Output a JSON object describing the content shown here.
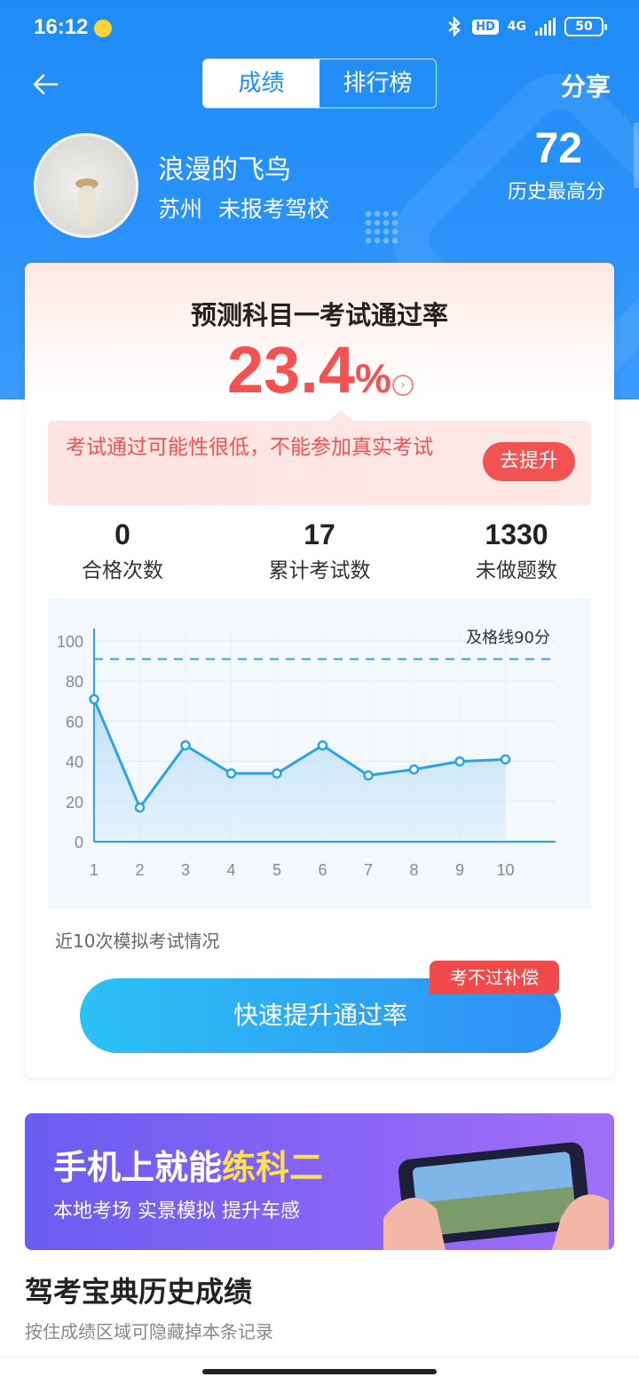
{
  "status_bar": {
    "time": "16:12",
    "network": "4G",
    "hd": "HD",
    "battery": "50"
  },
  "header": {
    "tabs": [
      {
        "label": "成绩",
        "active": true
      },
      {
        "label": "排行榜",
        "active": false
      }
    ],
    "share_label": "分享"
  },
  "profile": {
    "name": "浪漫的飞鸟",
    "city": "苏州",
    "school": "未报考驾校",
    "best_score": "72",
    "best_score_label": "历史最高分"
  },
  "prediction": {
    "title": "预测科目一考试通过率",
    "value": "23.4",
    "unit": "%",
    "alert_text": "考试通过可能性很低，不能参加真实考试",
    "alert_button": "去提升"
  },
  "stats": [
    {
      "value": "0",
      "label": "合格次数"
    },
    {
      "value": "17",
      "label": "累计考试数"
    },
    {
      "value": "1330",
      "label": "未做题数"
    }
  ],
  "chart_data": {
    "type": "area",
    "x": [
      1,
      2,
      3,
      4,
      5,
      6,
      7,
      8,
      9,
      10
    ],
    "values": [
      71,
      17,
      48,
      34,
      34,
      48,
      33,
      36,
      40,
      41
    ],
    "yticks": [
      0,
      20,
      40,
      60,
      80,
      100
    ],
    "ylim": [
      0,
      100
    ],
    "threshold": {
      "value": 91,
      "label": "及格线90分"
    },
    "colors": {
      "line": "#2ba4e6",
      "fill": "#bfe0f7",
      "threshold": "#2ba4e6"
    }
  },
  "chart_caption": "近10次模拟考试情况",
  "cta": {
    "label": "快速提升通过率",
    "badge": "考不过补偿"
  },
  "banner": {
    "title_prefix": "手机上就能",
    "title_highlight": "练科二",
    "subtitle": "本地考场 实景模拟 提升车感"
  },
  "history": {
    "title": "驾考宝典历史成绩",
    "subtitle": "按住成绩区域可隐藏掉本条记录"
  },
  "colors": {
    "primary": "#1f8bf5",
    "danger": "#f25252",
    "highlight": "#ffe14d"
  }
}
